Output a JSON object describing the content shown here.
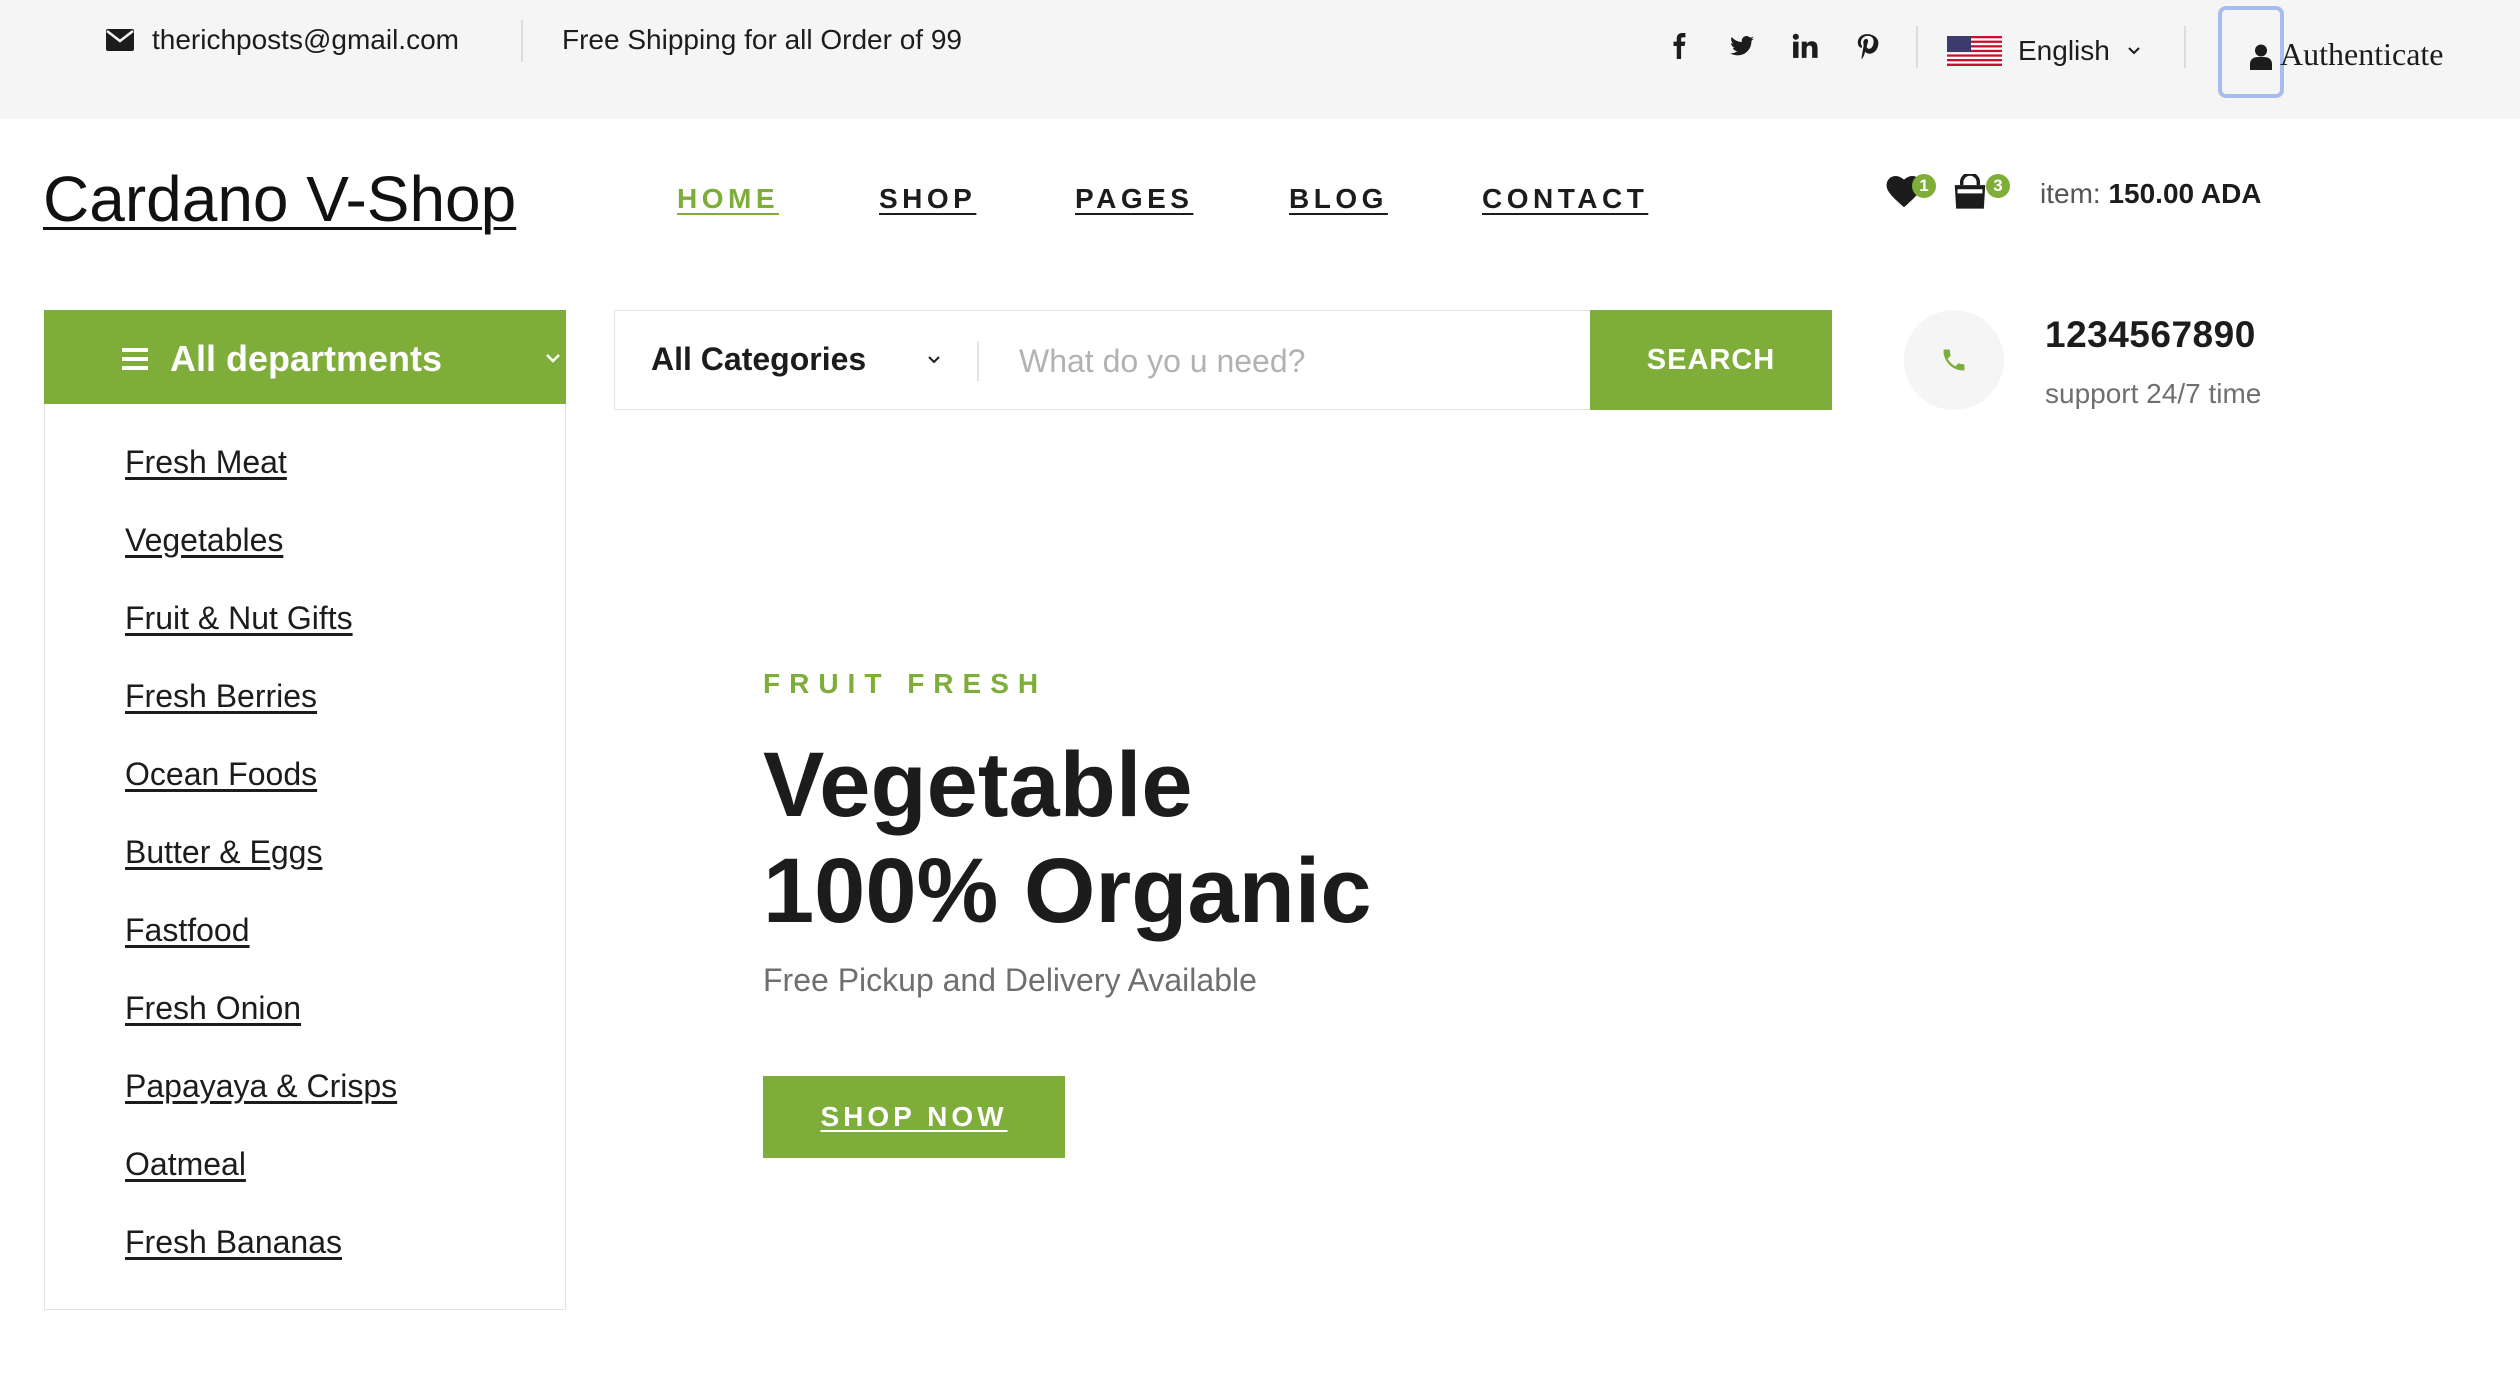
{
  "topbar": {
    "email": "therichposts@gmail.com",
    "shipping": "Free Shipping for all Order of 99",
    "social": [
      "facebook-icon",
      "twitter-icon",
      "linkedin-icon",
      "pinterest-icon"
    ],
    "language": "English",
    "auth_label": "Authenticate"
  },
  "header": {
    "logo": "Cardano V-Shop",
    "nav": [
      "HOME",
      "SHOP",
      "PAGES",
      "BLOG",
      "CONTACT"
    ],
    "active_nav": "HOME",
    "wishlist_count": "1",
    "cart_count": "3",
    "cart_label": "item:",
    "cart_total": "150.00 ADA"
  },
  "departments": {
    "title": "All departments",
    "items": [
      "Fresh Meat",
      "Vegetables",
      "Fruit & Nut Gifts",
      "Fresh Berries",
      "Ocean Foods",
      "Butter & Eggs",
      "Fastfood",
      "Fresh Onion",
      "Papayaya & Crisps",
      "Oatmeal",
      "Fresh Bananas"
    ]
  },
  "search": {
    "category": "All Categories",
    "placeholder": "What do yo u need?",
    "value": "",
    "button": "SEARCH"
  },
  "contact": {
    "phone": "1234567890",
    "support": "support 24/7 time"
  },
  "hero": {
    "kicker": "FRUIT FRESH",
    "title_line1": "Vegetable",
    "title_line2": "100% Organic",
    "subtitle": "Free Pickup and Delivery Available",
    "cta": "SHOP NOW"
  },
  "colors": {
    "accent": "#7fad39",
    "topbar_bg": "#f5f5f5",
    "text": "#1c1c1c",
    "focus_ring": "#a9bcf0"
  }
}
